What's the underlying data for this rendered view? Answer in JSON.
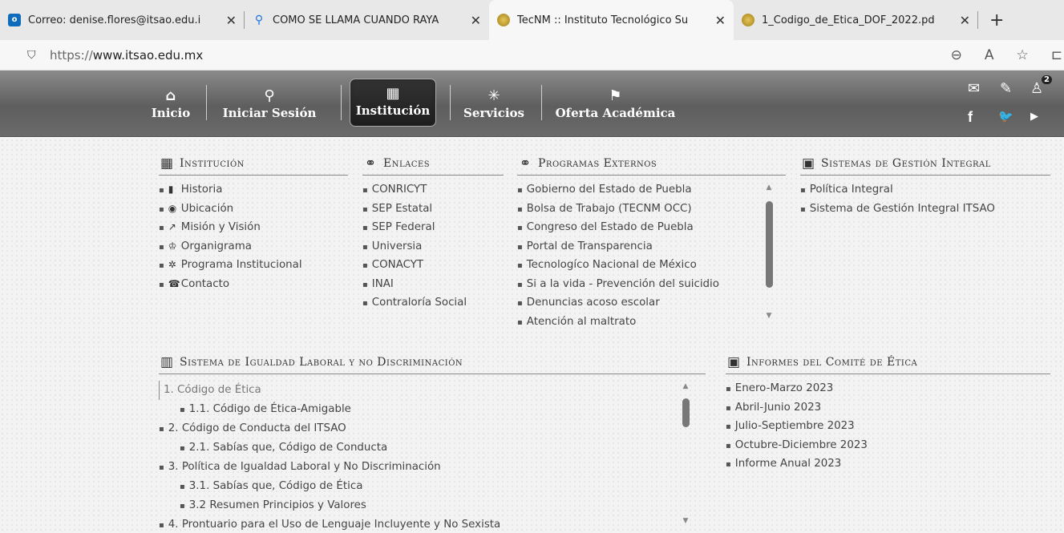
{
  "browser": {
    "tabs": [
      {
        "title": "Correo: denise.flores@itsao.edu.i",
        "icon": "outlook-icon",
        "icon_color": "#0f6cbd"
      },
      {
        "title": "COMO SE LLAMA CUANDO RAYA",
        "icon": "search-icon",
        "icon_color": "#1a73e8"
      },
      {
        "title": "TecNM :: Instituto Tecnológico Su",
        "icon": "site-favicon",
        "icon_color": "#c8a42a"
      },
      {
        "title": "1_Codigo_de_Etica_DOF_2022.pd",
        "icon": "site-favicon",
        "icon_color": "#c8a42a"
      }
    ],
    "new_tab": "+",
    "close_glyph": "✕",
    "url_proto": "https://",
    "url_host": "www.itsao.edu.mx",
    "lock_glyph": "⛉",
    "zoom_glyph": "⊖",
    "read_glyph": "A",
    "fav_glyph": "☆",
    "more_glyph": "⊏"
  },
  "nav": {
    "items": [
      {
        "label": "Inicio",
        "icon": "⌂"
      },
      {
        "label": "Iniciar Sesión",
        "icon": "⚲"
      },
      {
        "label": "Institución",
        "icon": "▦"
      },
      {
        "label": "Servicios",
        "icon": "✳"
      },
      {
        "label": "Oferta Académica",
        "icon": "⚑"
      }
    ],
    "right": {
      "mail": "✉",
      "edit": "✎",
      "user": "♙",
      "badge": "2",
      "facebook": "f",
      "twitter": "🐦",
      "youtube": "▶"
    }
  },
  "institucion": {
    "title": "Institución",
    "icon": "▦",
    "items": [
      {
        "icon": "▮",
        "label": "Historia"
      },
      {
        "icon": "◉",
        "label": "Ubicación"
      },
      {
        "icon": "↗",
        "label": "Misión y Visión"
      },
      {
        "icon": "♔",
        "label": "Organigrama"
      },
      {
        "icon": "✲",
        "label": "Programa Institucional"
      },
      {
        "icon": "☎",
        "label": "Contacto"
      }
    ]
  },
  "enlaces": {
    "title": "Enlaces",
    "icon": "⚭",
    "items": [
      "CONRICYT",
      "SEP Estatal",
      "SEP Federal",
      "Universia",
      "CONACYT",
      "INAI",
      "Contraloría Social"
    ]
  },
  "programas": {
    "title": "Programas Externos",
    "icon": "⚭",
    "items": [
      "Gobierno del Estado de Puebla",
      "Bolsa de Trabajo (TECNM OCC)",
      "Congreso del Estado de Puebla",
      "Portal de Transparencia",
      "Tecnologíco Nacional de México",
      "Si a la vida - Prevención del suicidio",
      "Denuncias acoso escolar",
      "Atención al maltrato"
    ]
  },
  "sgi": {
    "title": "Sistemas de Gestión Integral",
    "icon": "▣",
    "items": [
      "Política Integral",
      "Sistema de Gestión Integral ITSAO"
    ]
  },
  "igualdad": {
    "title": "Sistema de Igualdad Laboral y no Discriminación",
    "icon": "▥",
    "items": [
      {
        "label": "1. Código de Ética",
        "level": 0
      },
      {
        "label": "1.1. Código de Ética-Amigable",
        "level": 1
      },
      {
        "label": "2. Código de Conducta del ITSAO",
        "level": 0
      },
      {
        "label": "2.1. Sabías que, Código de Conducta",
        "level": 1
      },
      {
        "label": "3. Política de Igualdad Laboral y No Discriminación",
        "level": 0
      },
      {
        "label": "3.1. Sabías que, Código de Ética",
        "level": 1
      },
      {
        "label": "3.2 Resumen Principios y Valores",
        "level": 1
      },
      {
        "label": "4. Prontuario para el Uso de Lenguaje Incluyente y No Sexista",
        "level": 0
      }
    ]
  },
  "informes": {
    "title": "Informes del Comité de Ética",
    "icon": "▣",
    "items": [
      "Enero-Marzo 2023",
      "Abril-Junio 2023",
      "Julio-Septiembre 2023",
      "Octubre-Diciembre 2023",
      "Informe Anual 2023"
    ]
  },
  "scroll": {
    "up": "▲",
    "down": "▼"
  }
}
